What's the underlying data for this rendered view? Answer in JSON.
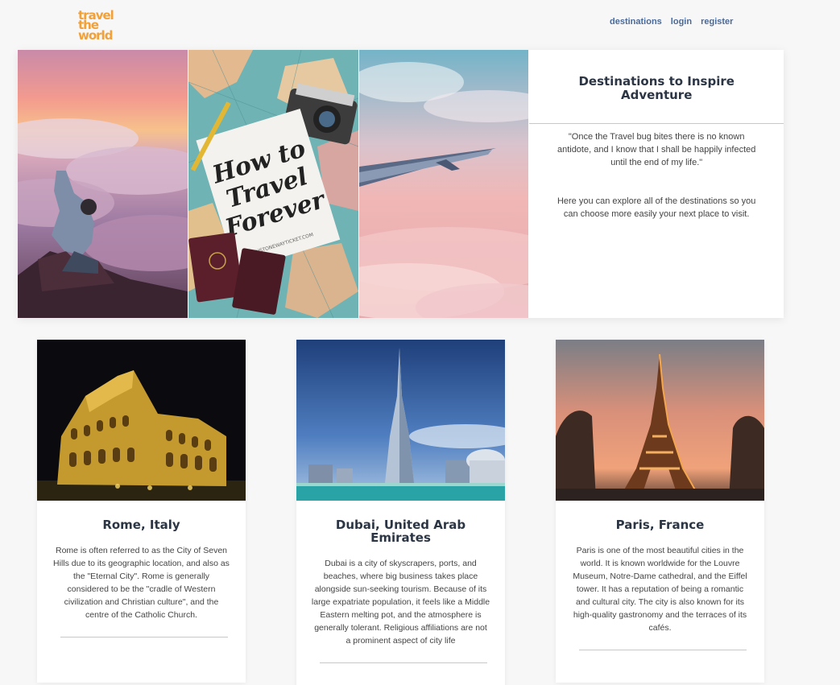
{
  "logo": {
    "line1": "travel",
    "line2": "the",
    "line3": "world"
  },
  "nav": {
    "destinations": "destinations",
    "login": "login",
    "register": "register"
  },
  "hero": {
    "title": "Destinations to Inspire Adventure",
    "quote": "\"Once the Travel bug bites there is no known antidote, and I know that I shall be happily infected until the end of my life.\"",
    "description": "Here you can explore all of the destinations so you can choose more easily your next place to visit.",
    "book_cover": {
      "line1": "How to",
      "line2": "Travel",
      "line3": "Forever",
      "site": "JUSTONEWAYTICKET.COM"
    }
  },
  "cards": [
    {
      "title": "Rome, Italy",
      "text": "Rome is often referred to as the City of Seven Hills due to its geographic location, and also as the \"Eternal City\". Rome is generally considered to be the \"cradle of Western civilization and Christian culture\", and the centre of the Catholic Church."
    },
    {
      "title": "Dubai, United Arab Emirates",
      "text": "Dubai is a city of skyscrapers, ports, and beaches, where big business takes place alongside sun-seeking tourism. Because of its large expatriate population, it feels like a Middle Eastern melting pot, and the atmosphere is generally tolerant. Religious affiliations are not a prominent aspect of city life"
    },
    {
      "title": "Paris, France",
      "text": "Paris is one of the most beautiful cities in the world. It is known worldwide for the Louvre Museum, Notre-Dame cathedral, and the Eiffel tower. It has a reputation of being a romantic and cultural city. The city is also known for its high-quality gastronomy and the terraces of its cafés."
    }
  ],
  "colors": {
    "accent": "#f2a03a",
    "nav": "#4a6a9a",
    "heading": "#2b3544"
  }
}
